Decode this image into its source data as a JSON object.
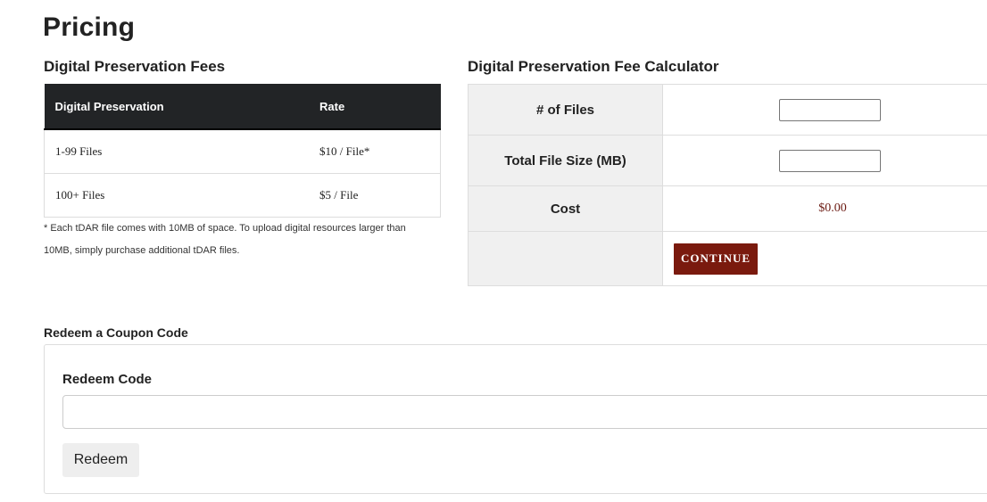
{
  "page": {
    "title": "Pricing"
  },
  "fees": {
    "heading": "Digital Preservation Fees",
    "columns": [
      "Digital Preservation",
      "Rate"
    ],
    "rows": [
      {
        "label": "1-99 Files",
        "rate": "$10 / File*"
      },
      {
        "label": "100+ Files",
        "rate": "$5 / File"
      }
    ],
    "footnote": "* Each tDAR file comes with 10MB of space. To upload digital resources larger than 10MB, simply purchase additional tDAR files."
  },
  "calculator": {
    "heading": "Digital Preservation Fee Calculator",
    "files_label": "# of Files",
    "files_value": "",
    "size_label": "Total File Size (MB)",
    "size_value": "",
    "cost_label": "Cost",
    "cost_value": "$0.00",
    "continue_label": "CONTINUE"
  },
  "coupon": {
    "heading": "Redeem a Coupon Code",
    "field_label": "Redeem Code",
    "field_value": "",
    "button_label": "Redeem"
  },
  "colors": {
    "header_bg": "#222426",
    "continue_bg": "#7a1a0e",
    "cost_text": "#6b1a12"
  }
}
